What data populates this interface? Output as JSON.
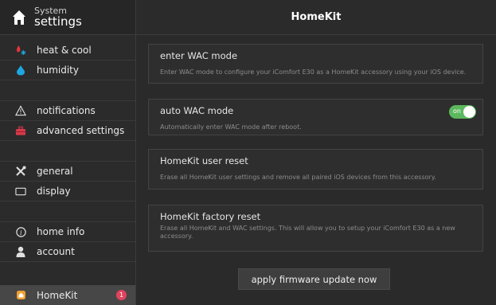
{
  "sidebar": {
    "title_small": "System",
    "title_large": "settings",
    "items": [
      {
        "label": "heat & cool"
      },
      {
        "label": "humidity"
      },
      {
        "label": "notifications"
      },
      {
        "label": "advanced settings"
      },
      {
        "label": "general"
      },
      {
        "label": "display"
      },
      {
        "label": "home info"
      },
      {
        "label": "account"
      },
      {
        "label": "HomeKit",
        "badge": "1"
      }
    ]
  },
  "main": {
    "title": "HomeKit",
    "cards": [
      {
        "title": "enter WAC mode",
        "desc": "Enter WAC mode to configure your iComfort E30 as a HomeKit accessory using your iOS device."
      },
      {
        "title": "auto WAC mode",
        "desc": "Automatically enter WAC mode after reboot.",
        "toggle_label": "on"
      },
      {
        "title": "HomeKit user reset",
        "desc": "Erase all HomeKit user settings and remove all paired iOS devices from this accessory."
      },
      {
        "title": "HomeKit factory reset",
        "desc": "Erase all HomeKit and WAC settings. This will allow you to setup your iComfort E30 as a new accessory."
      }
    ],
    "firmware_button": "apply firmware update now"
  },
  "colors": {
    "toggle_on": "#5cb85c",
    "badge": "#e2435d",
    "humidity_icon": "#1ea7e1",
    "heat_icon": "#e8343b",
    "advanced_icon": "#d83a4a",
    "homekit_icon": "#f0a030"
  }
}
